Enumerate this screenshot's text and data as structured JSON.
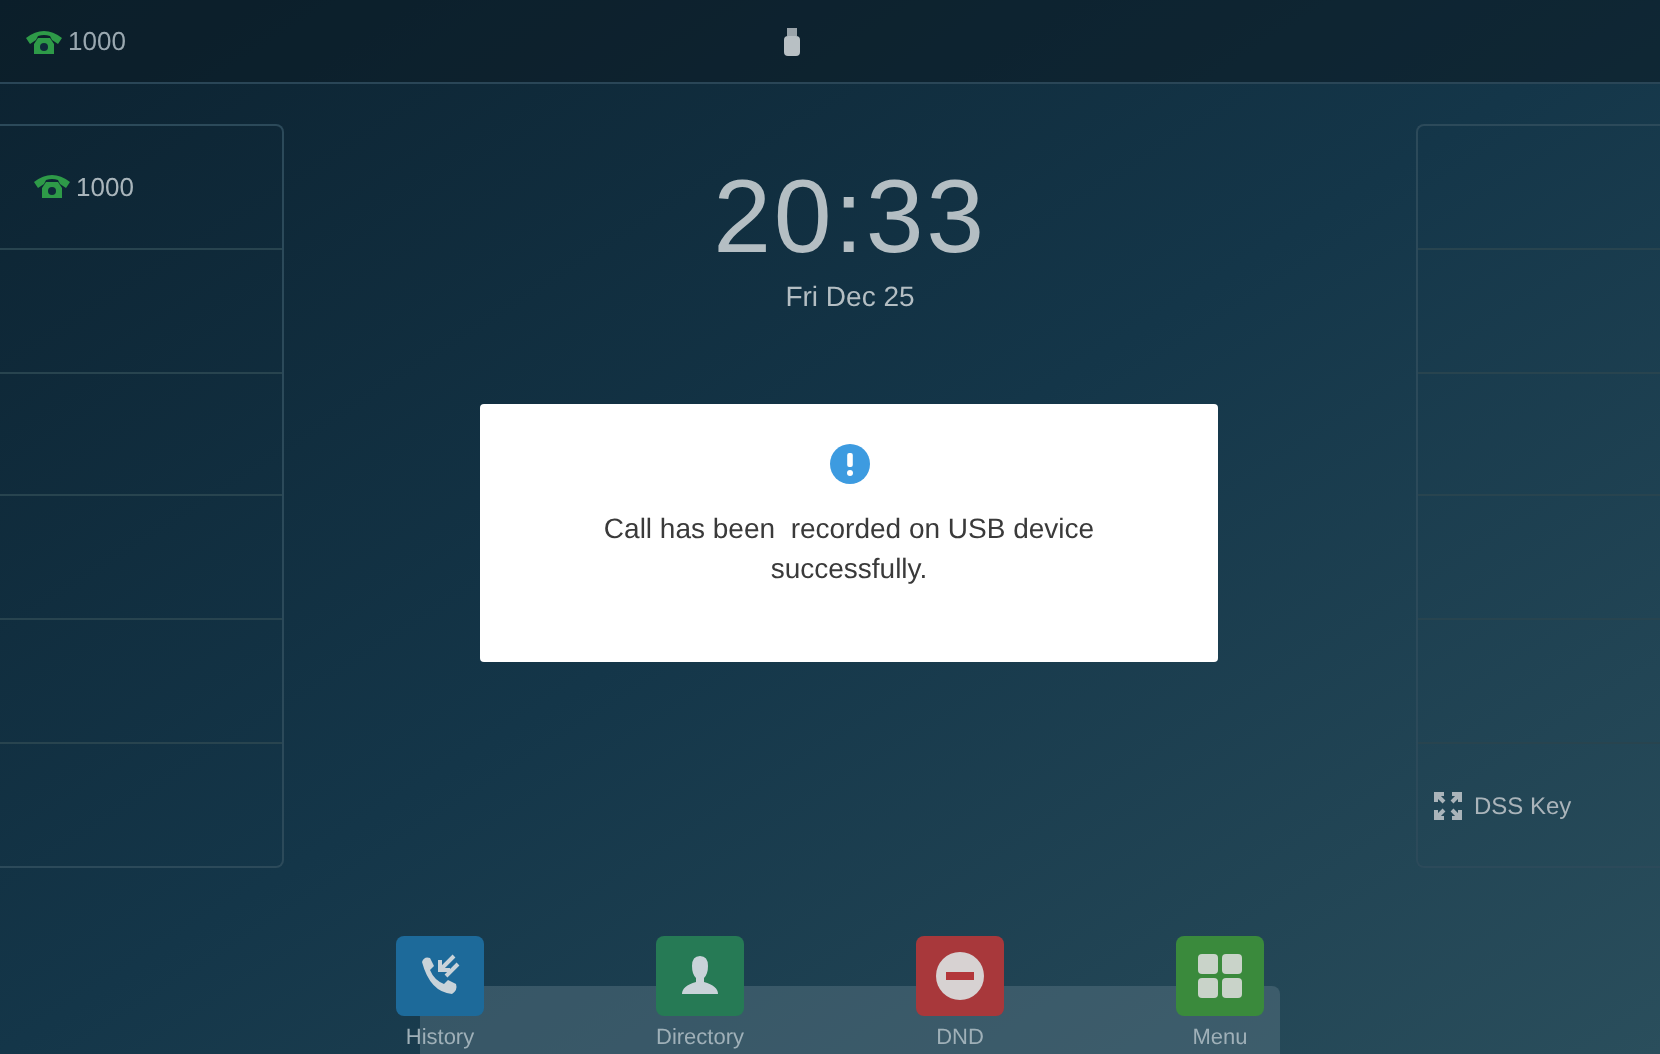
{
  "status_bar": {
    "account": "1000"
  },
  "left_panel": {
    "lines": [
      {
        "label": "1000",
        "kind": "line"
      },
      {
        "kind": "empty"
      },
      {
        "kind": "empty"
      },
      {
        "kind": "empty"
      },
      {
        "kind": "empty"
      },
      {
        "kind": "empty"
      }
    ]
  },
  "clock": {
    "time": "20:33",
    "date": "Fri Dec 25"
  },
  "right_panel": {
    "keys": [
      {
        "kind": "empty"
      },
      {
        "kind": "empty"
      },
      {
        "kind": "empty"
      },
      {
        "kind": "empty"
      },
      {
        "kind": "empty"
      },
      {
        "label": "DSS Key",
        "kind": "dss"
      }
    ]
  },
  "dialog": {
    "message": "Call has been  recorded on USB device successfully."
  },
  "dock": [
    {
      "label": "History",
      "kind": "history"
    },
    {
      "label": "Directory",
      "kind": "directory"
    },
    {
      "label": "DND",
      "kind": "dnd"
    },
    {
      "label": "Menu",
      "kind": "menu"
    }
  ]
}
